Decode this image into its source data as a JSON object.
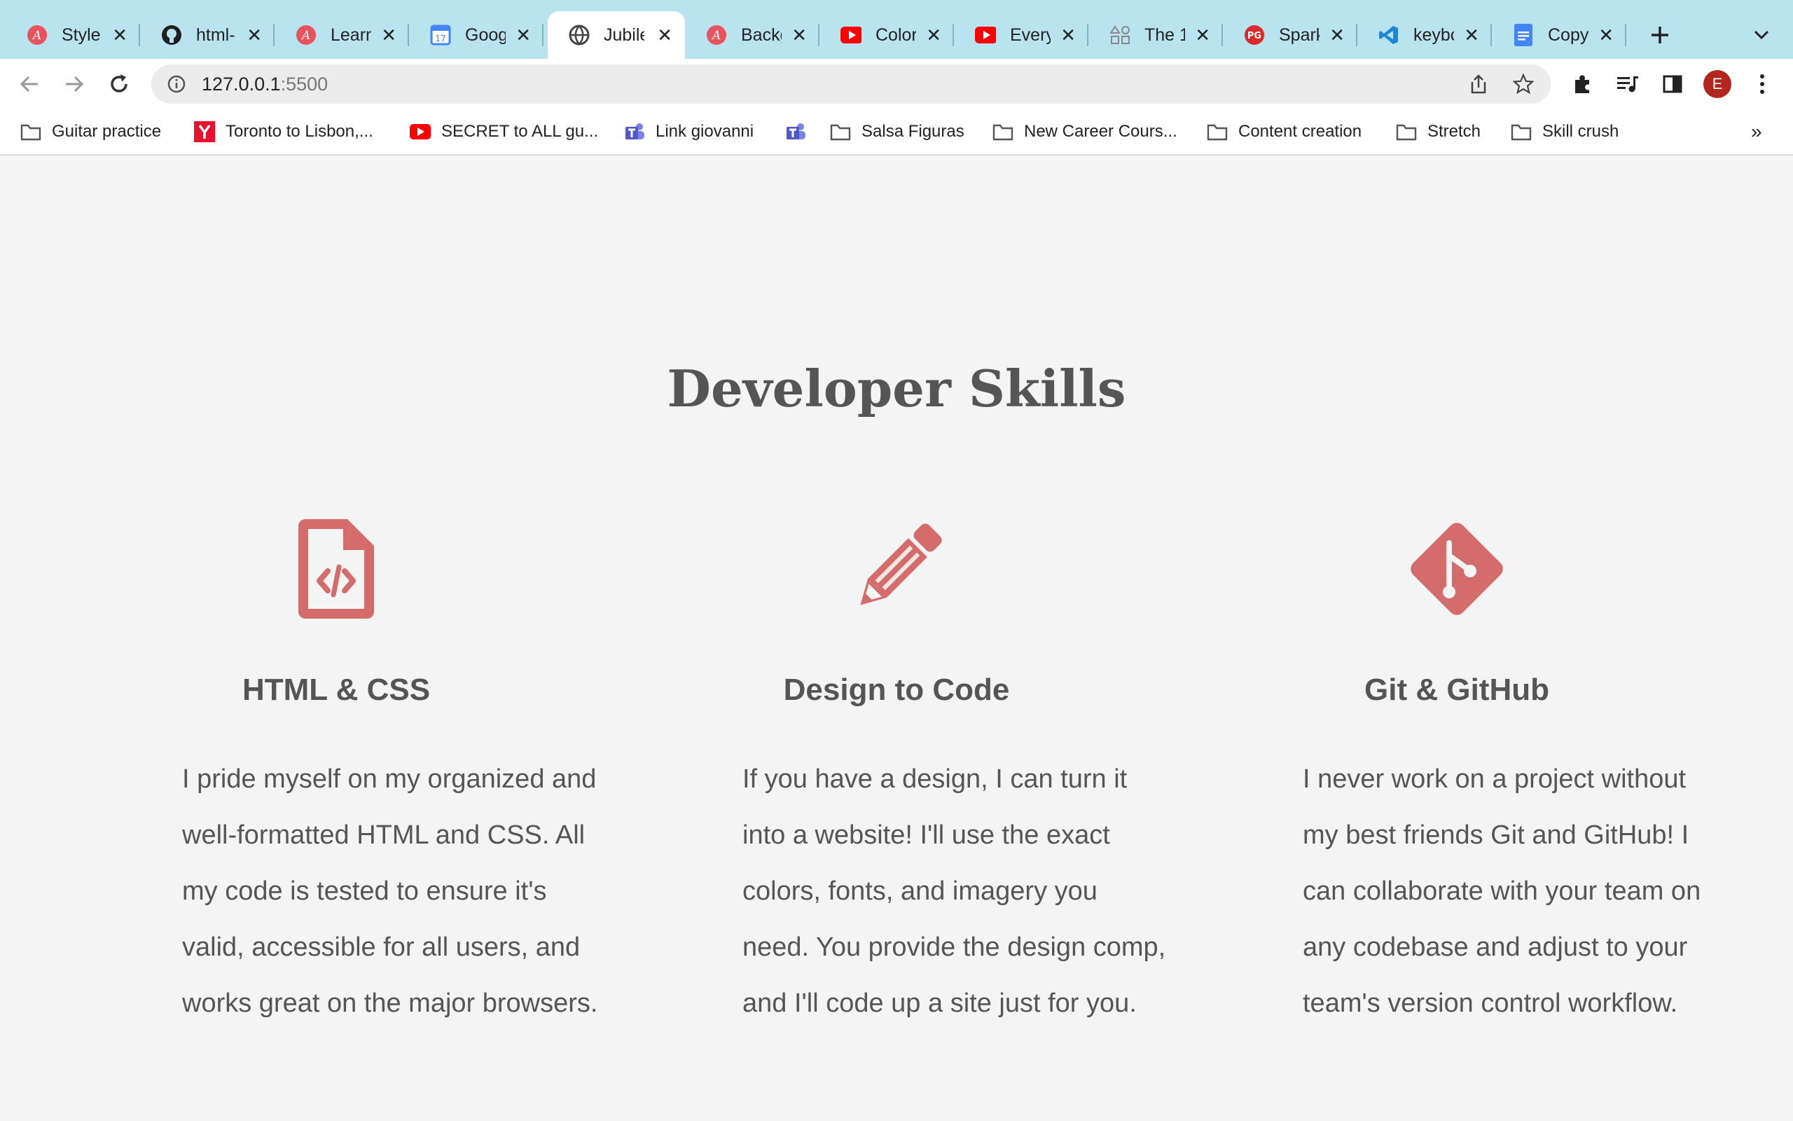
{
  "browser": {
    "tabs": [
      {
        "title": "Style",
        "icon": "codecademy-icon"
      },
      {
        "title": "html-",
        "icon": "github-icon"
      },
      {
        "title": "Learn",
        "icon": "codecademy-icon"
      },
      {
        "title": "Googl",
        "icon": "google-calendar-icon"
      },
      {
        "title": "Jubile",
        "icon": "globe-icon",
        "active": true
      },
      {
        "title": "Backg",
        "icon": "codecademy-icon"
      },
      {
        "title": "Color",
        "icon": "youtube-icon"
      },
      {
        "title": "Every",
        "icon": "youtube-icon"
      },
      {
        "title": "The 1",
        "icon": "shapes-icon"
      },
      {
        "title": "Spark",
        "icon": "pg-icon"
      },
      {
        "title": "keybc",
        "icon": "vscode-icon"
      },
      {
        "title": "Copy",
        "icon": "google-docs-icon"
      }
    ],
    "address": {
      "host": "127.0.0.1",
      "port": ":5500"
    },
    "profile_initial": "E",
    "bookmarks": [
      {
        "label": "Guitar practice",
        "icon": "folder-icon"
      },
      {
        "label": "Toronto to Lisbon,...",
        "icon": "yelp-icon"
      },
      {
        "label": "SECRET to ALL gu...",
        "icon": "youtube-icon"
      },
      {
        "label": "Link giovanni",
        "icon": "teams-icon"
      },
      {
        "label": "",
        "icon": "teams-icon"
      },
      {
        "label": "Salsa Figuras",
        "icon": "folder-icon"
      },
      {
        "label": "New Career Cours...",
        "icon": "folder-icon"
      },
      {
        "label": "Content creation",
        "icon": "folder-icon"
      },
      {
        "label": "Stretch",
        "icon": "folder-icon"
      },
      {
        "label": "Skill crush",
        "icon": "folder-icon"
      }
    ],
    "bookmarks_overflow": "»"
  },
  "page": {
    "title": "Developer Skills",
    "accent_color": "#d56c6c",
    "skills": [
      {
        "icon": "file-code-icon",
        "heading": "HTML & CSS",
        "lines": [
          "I pride myself on my organized and",
          "well-formatted HTML and CSS. All",
          "my code is tested to ensure it's",
          "valid, accessible for all users, and",
          "works great on the major browsers."
        ]
      },
      {
        "icon": "pencil-icon",
        "heading": "Design to Code",
        "lines": [
          "If you have a design, I can turn it",
          "into a website! I'll use the exact",
          "colors, fonts, and imagery you",
          "need. You provide the design comp,",
          "and I'll code up a site just for you."
        ]
      },
      {
        "icon": "git-icon",
        "heading": "Git & GitHub",
        "lines": [
          "I never work on a project without",
          "my best friends Git and GitHub! I",
          "can collaborate with your team on",
          "any codebase and adjust to your",
          "team's version control workflow."
        ]
      }
    ]
  }
}
